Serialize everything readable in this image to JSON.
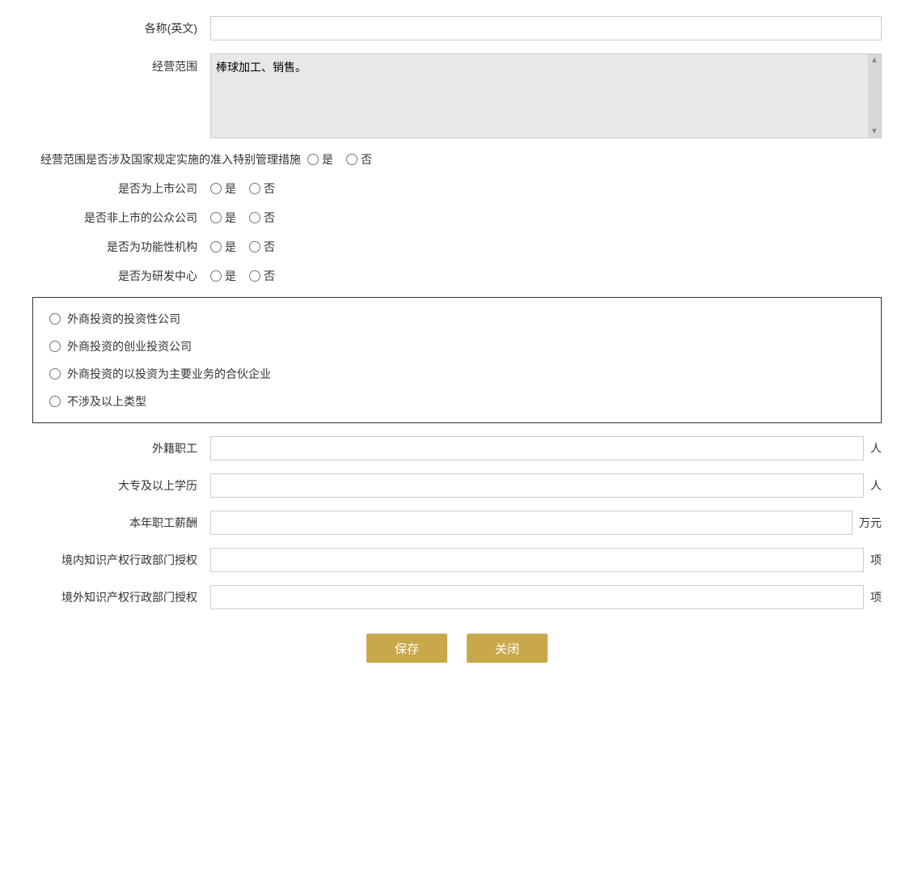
{
  "form": {
    "name_en_label": "各称(英文)",
    "name_en_value": "",
    "scope_label": "经营范围",
    "scope_value": "棒球加工、销售。",
    "special_mgmt_label": "经营范围是否涉及国家规定实施的准入特别管理措施",
    "yes_label": "是",
    "no_label": "否",
    "listed_company_label": "是否为上市公司",
    "public_company_label": "是否非上市的公众公司",
    "functional_org_label": "是否为功能性机构",
    "rd_center_label": "是否为研发中心",
    "investment_company_label": "外商投资的投资性公司",
    "venture_capital_label": "外商投资的创业投资公司",
    "partnership_label": "外商投资的以投资为主要业务的合伙企业",
    "not_applicable_label": "不涉及以上类型",
    "foreign_staff_label": "外籍职工",
    "foreign_staff_unit": "人",
    "college_education_label": "大专及以上学历",
    "college_education_unit": "人",
    "annual_salary_label": "本年职工薪酬",
    "annual_salary_unit": "万元",
    "domestic_ip_label": "境内知识产权行政部门授权",
    "domestic_ip_unit": "项",
    "foreign_ip_label": "境外知识产权行政部门授权",
    "foreign_ip_unit": "项",
    "save_btn": "保存",
    "close_btn": "关闭"
  }
}
